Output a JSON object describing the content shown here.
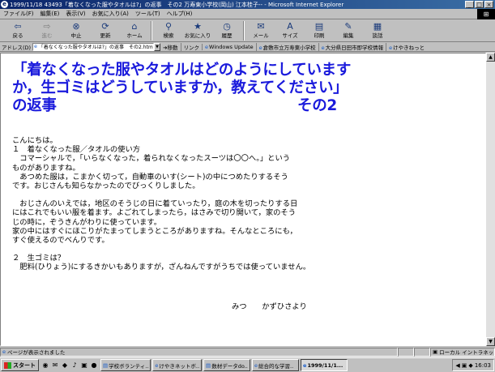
{
  "window": {
    "title": "1999/11/18 43493「着なくなった服やタオルは?」の返事　その2 万寿東小学校(岡山) 江本桂子-- - Microsoft Internet Explorer",
    "buttons": [
      "_",
      "□",
      "×"
    ]
  },
  "menu": [
    "ファイル(F)",
    "編集(E)",
    "表示(V)",
    "お気に入り(A)",
    "ツール(T)",
    "ヘルプ(H)"
  ],
  "toolbar": [
    {
      "label": "戻る",
      "icon": "back-icon",
      "glyph": "⇦",
      "enabled": true
    },
    {
      "label": "進む",
      "icon": "forward-icon",
      "glyph": "⇨",
      "enabled": false
    },
    {
      "label": "中止",
      "icon": "stop-icon",
      "glyph": "⊗",
      "enabled": true
    },
    {
      "label": "更新",
      "icon": "refresh-icon",
      "glyph": "⟳",
      "enabled": true
    },
    {
      "label": "ホーム",
      "icon": "home-icon",
      "glyph": "⌂",
      "enabled": true
    },
    {
      "label": "検索",
      "icon": "search-icon",
      "glyph": "⚲",
      "enabled": true
    },
    {
      "label": "お気に入り",
      "icon": "favorites-icon",
      "glyph": "★",
      "enabled": true
    },
    {
      "label": "履歴",
      "icon": "history-icon",
      "glyph": "◷",
      "enabled": true
    },
    {
      "label": "メール",
      "icon": "mail-icon",
      "glyph": "✉",
      "enabled": true
    },
    {
      "label": "サイズ",
      "icon": "font-size-icon",
      "glyph": "A",
      "enabled": true
    },
    {
      "label": "印刷",
      "icon": "print-icon",
      "glyph": "▤",
      "enabled": true
    },
    {
      "label": "編集",
      "icon": "edit-icon",
      "glyph": "✎",
      "enabled": true
    },
    {
      "label": "談話",
      "icon": "discuss-icon",
      "glyph": "▦",
      "enabled": true
    }
  ],
  "address": {
    "label": "アドレス(D)",
    "value": "「着なくなった服やタオルは?」の返事　その2.htm",
    "go": "移動",
    "links_label": "リンク",
    "links": [
      "Windows Update",
      "倉敷市立万寿東小学校",
      "大分県日田市即学校情報",
      "けやきねっと"
    ]
  },
  "page": {
    "title_main": "「着なくなった服やタオルはどのようにしていますか，生ゴミはどうしていますか，教えてください」の返事",
    "title_suffix": "その2",
    "lines": [
      "こんにちは。",
      "１　着なくなった服／タオルの使い方",
      "　コマーシャルで，「いらなくなった，着られなくなったスーツは〇〇へ。」という",
      "ものがありますね。",
      "　あつめた服は，こまかく切って，自動車のいす(シート)の中につめたりするそう",
      "です。おじさんも知らなかったのでびっくりしました。",
      "",
      "　おじさんのいえでは，地区のそうじの日に着ていったり，庭の木を切ったりする日",
      "にはこれでもいい服を着ます。よごれてしまったら，はさみで切り開いて，家のそう",
      "じの時に，ぞうきんがわりに使っています。",
      "家の中にはすぐにほこりがたまってしまうところがありますね。そんなところにも，",
      "すぐ使えるのでべんりです。",
      "",
      "２　生ゴミは？",
      "　肥料(ひりょう)にするきかいもありますが，ざんねんですがうちでは使っていません。"
    ],
    "signature": "みつ　　かずひさより"
  },
  "status": {
    "text": "ページが表示されました",
    "zone": "ローカル イントラネット"
  },
  "taskbar": {
    "start": "スタート",
    "quick_launch": [
      "◉",
      "✉",
      "◆",
      "♪",
      "▣",
      "●"
    ],
    "tasks": [
      "学校ボランティ..",
      "けやきネットボ..",
      "数材データdo..",
      "総合的な学習..",
      "1999/11/1..."
    ],
    "active_task": 4,
    "clock": "16:03"
  },
  "colors": {
    "title_text": "#1a1adc",
    "titlebar_start": "#0a246a",
    "titlebar_end": "#3a6ea5"
  }
}
